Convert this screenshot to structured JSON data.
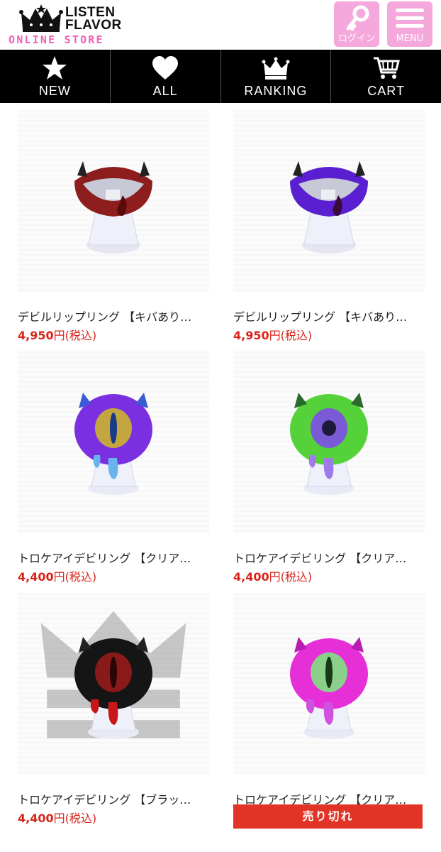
{
  "header": {
    "logo_line1": "LISTEN",
    "logo_line2": "FLAVOR",
    "logo_line3": "ONLINE STORE",
    "login_label": "ログイン",
    "menu_label": "MENU",
    "accent_pink": "#f4a8dc",
    "logo_pink": "#f060b6"
  },
  "nav": {
    "items": [
      {
        "label": "NEW",
        "icon": "star-icon"
      },
      {
        "label": "ALL",
        "icon": "heart-icon"
      },
      {
        "label": "RANKING",
        "icon": "crown-icon"
      },
      {
        "label": "CART",
        "icon": "cart-icon"
      }
    ]
  },
  "products": [
    {
      "name": "デビルリップリング 【キバあり…",
      "price": "4,950",
      "price_suffix": "円(税込)",
      "color": "#8e1d1d"
    },
    {
      "name": "デビルリップリング 【キバあり…",
      "price": "4,950",
      "price_suffix": "円(税込)",
      "color": "#5a1fd0"
    },
    {
      "name": "トロケアイデビリング 【クリア…",
      "price": "4,400",
      "price_suffix": "円(税込)",
      "color": "#7a2fe0"
    },
    {
      "name": "トロケアイデビリング 【クリア…",
      "price": "4,400",
      "price_suffix": "円(税込)",
      "color": "#55d23a"
    },
    {
      "name": "トロケアイデビリング 【ブラッ…",
      "price": "4,400",
      "price_suffix": "円(税込)",
      "color": "#151515"
    },
    {
      "name": "トロケアイデビリング 【クリア…",
      "soldout": "売り切れ",
      "color": "#e62fd6"
    }
  ],
  "price_color": "#d9241b",
  "soldout_color": "#e23426"
}
